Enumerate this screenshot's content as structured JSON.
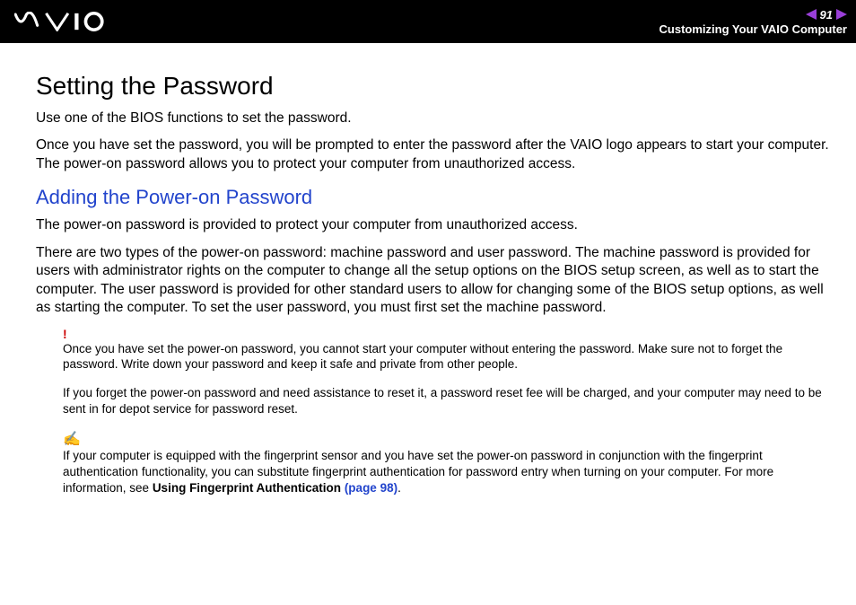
{
  "header": {
    "page_number": "91",
    "breadcrumb": "Customizing Your VAIO Computer"
  },
  "main": {
    "title": "Setting the Password",
    "intro1": "Use one of the BIOS functions to set the password.",
    "intro2": "Once you have set the password, you will be prompted to enter the password after the VAIO logo appears to start your computer. The power-on password allows you to protect your computer from unauthorized access.",
    "subheading": "Adding the Power-on Password",
    "sub_p1": "The power-on password is provided to protect your computer from unauthorized access.",
    "sub_p2": "There are two types of the power-on password: machine password and user password. The machine password is provided for users with administrator rights on the computer to change all the setup options on the BIOS setup screen, as well as to start the computer. The user password is provided for other standard users to allow for changing some of the BIOS setup options, as well as starting the computer. To set the user password, you must first set the machine password.",
    "warn_mark": "!",
    "warn_text1": "Once you have set the power-on password, you cannot start your computer without entering the password. Make sure not to forget the password. Write down your password and keep it safe and private from other people.",
    "warn_text2": "If you forget the power-on password and need assistance to reset it, a password reset fee will be charged, and your computer may need to be sent in for depot service for password reset.",
    "tip_mark": "✍",
    "tip_text_part1": "If your computer is equipped with the fingerprint sensor and you have set the power-on password in conjunction with the fingerprint authentication functionality, you can substitute fingerprint authentication for password entry when turning on your computer. For more information, see ",
    "tip_bold": "Using Fingerprint Authentication",
    "tip_link": " (page 98)",
    "tip_after": "."
  }
}
